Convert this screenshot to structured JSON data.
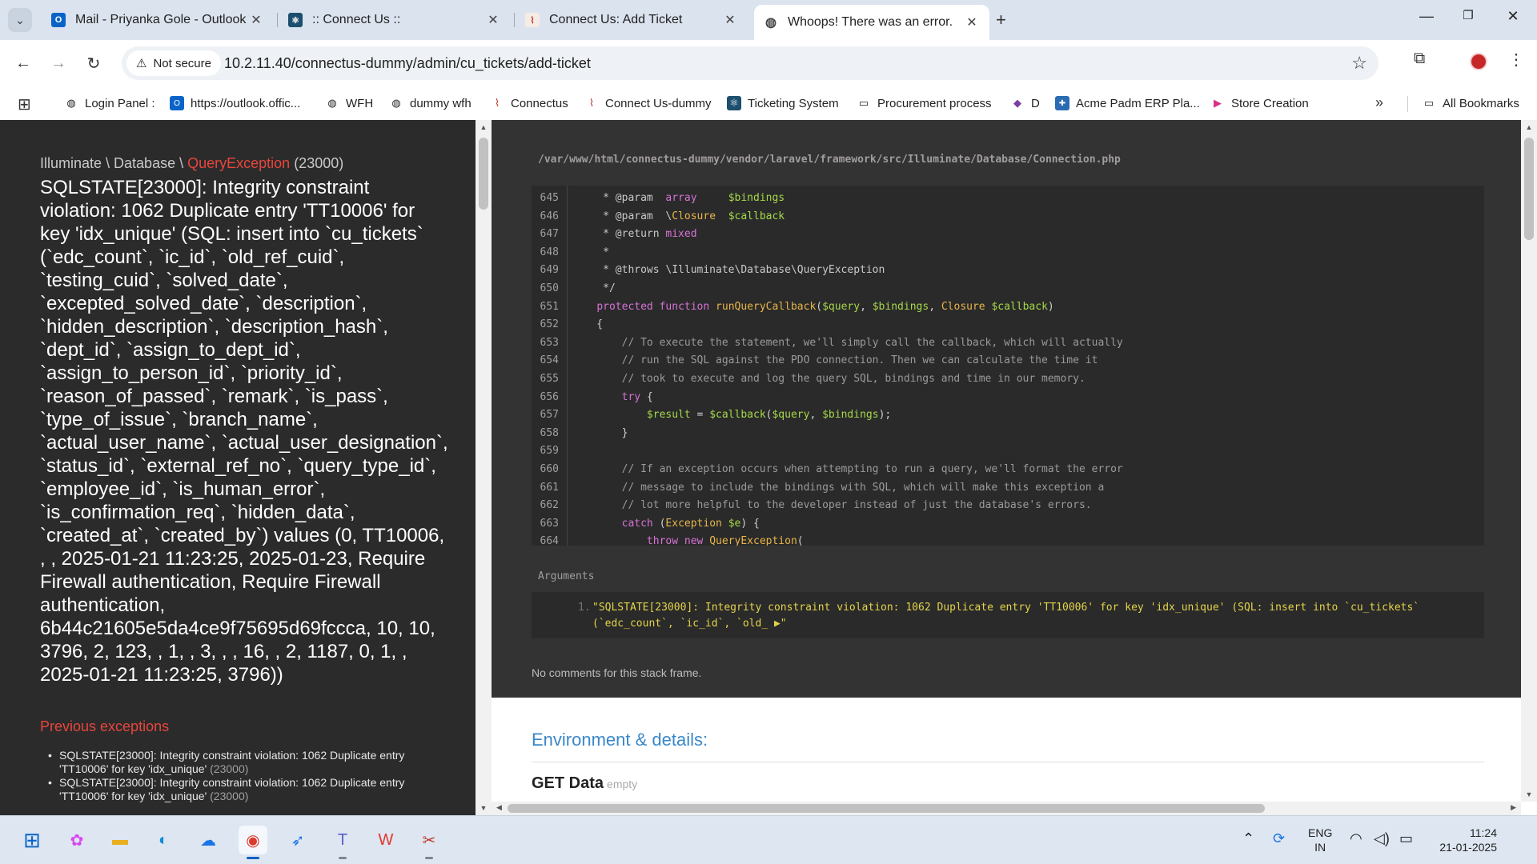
{
  "browser": {
    "tabs": [
      {
        "title": "Mail - Priyanka Gole - Outlook",
        "close": "✕"
      },
      {
        "title": ":: Connect Us ::",
        "close": "✕"
      },
      {
        "title": "Connect Us: Add Ticket",
        "close": "✕"
      },
      {
        "title": "Whoops! There was an error.",
        "close": "✕"
      }
    ],
    "new_tab": "+",
    "security_label": "Not secure",
    "url": "10.2.11.40/connectus-dummy/admin/cu_tickets/add-ticket",
    "bookmarks": [
      "Login Panel :",
      "https://outlook.offic...",
      "WFH",
      "dummy wfh",
      "Connectus",
      "Connect Us-dummy",
      "Ticketing System",
      "Procurement process",
      "D",
      "Acme Padm ERP Pla...",
      "Store Creation"
    ],
    "all_bookmarks": "All Bookmarks"
  },
  "error": {
    "namespace": "Illuminate \\ Database \\ ",
    "exception": "QueryException",
    "code": " (23000)",
    "message": "SQLSTATE[23000]: Integrity constraint violation: 1062 Duplicate entry 'TT10006' for key 'idx_unique' (SQL: insert into `cu_tickets` (`edc_count`, `ic_id`, `old_ref_cuid`, `testing_cuid`, `solved_date`, `excepted_solved_date`, `description`, `hidden_description`, `description_hash`, `dept_id`, `assign_to_dept_id`, `assign_to_person_id`, `priority_id`, `reason_of_passed`, `remark`, `is_pass`, `type_of_issue`, `branch_name`, `actual_user_name`, `actual_user_designation`, `status_id`, `external_ref_no`, `query_type_id`, `employee_id`, `is_human_error`, `is_confirmation_req`, `hidden_data`, `created_at`, `created_by`) values (0, TT10006, , , 2025-01-21 11:23:25, 2025-01-23, Require Firewall authentication, Require Firewall authentication, 6b44c21605e5da4ce9f75695d69fccca, 10, 10, 3796, 2, 123, , 1, , 3, , , 16, , 2, 1187, 0, 1, , 2025-01-21 11:23:25, 3796))",
    "previous_title": "Previous exceptions",
    "previous": [
      {
        "text": "SQLSTATE[23000]: Integrity constraint violation: 1062 Duplicate entry 'TT10006' for key 'idx_unique'",
        "code": " (23000)"
      },
      {
        "text": "SQLSTATE[23000]: Integrity constraint violation: 1062 Duplicate entry 'TT10006' for key 'idx_unique'",
        "code": " (23000)"
      }
    ]
  },
  "frame": {
    "file": "/var/www/html/connectus-dummy/vendor/laravel/framework/src/Illuminate/Database/Connection.php",
    "lines": [
      {
        "n": "645",
        "code": "     * @param  array     $bindings"
      },
      {
        "n": "646",
        "code": "     * @param  \\Closure  $callback"
      },
      {
        "n": "647",
        "code": "     * @return mixed"
      },
      {
        "n": "648",
        "code": "     *"
      },
      {
        "n": "649",
        "code": "     * @throws \\Illuminate\\Database\\QueryException"
      },
      {
        "n": "650",
        "code": "     */"
      },
      {
        "n": "651",
        "code": "    protected function runQueryCallback($query, $bindings, Closure $callback)"
      },
      {
        "n": "652",
        "code": "    {"
      },
      {
        "n": "653",
        "code": "        // To execute the statement, we'll simply call the callback, which will actually"
      },
      {
        "n": "654",
        "code": "        // run the SQL against the PDO connection. Then we can calculate the time it"
      },
      {
        "n": "655",
        "code": "        // took to execute and log the query SQL, bindings and time in our memory."
      },
      {
        "n": "656",
        "code": "        try {"
      },
      {
        "n": "657",
        "code": "            $result = $callback($query, $bindings);"
      },
      {
        "n": "658",
        "code": "        }"
      },
      {
        "n": "659",
        "code": ""
      },
      {
        "n": "660",
        "code": "        // If an exception occurs when attempting to run a query, we'll format the error"
      },
      {
        "n": "661",
        "code": "        // message to include the bindings with SQL, which will make this exception a"
      },
      {
        "n": "662",
        "code": "        // lot more helpful to the developer instead of just the database's errors."
      },
      {
        "n": "663",
        "code": "        catch (Exception $e) {"
      },
      {
        "n": "664",
        "code": "            throw new QueryException("
      }
    ],
    "arguments_title": "Arguments",
    "argument_number": "1.",
    "argument_text": "\"SQLSTATE[23000]: Integrity constraint violation: 1062 Duplicate entry 'TT10006' for key 'idx_unique' (SQL: insert into `cu_tickets` (`edc_count`, `ic_id`, `old_ ▶\"",
    "comments": "No comments for this stack frame."
  },
  "details": {
    "title": "Environment & details:",
    "get_title": "GET Data",
    "get_empty": "empty"
  },
  "taskbar": {
    "lang_1": "ENG",
    "lang_2": "IN",
    "time": "11:24",
    "date": "21-01-2025"
  },
  "colors": {
    "exception_red": "#e8453c",
    "args_yellow": "#e3d34a",
    "env_blue": "#3a87c8",
    "panel_dark": "#2b2b2b"
  }
}
